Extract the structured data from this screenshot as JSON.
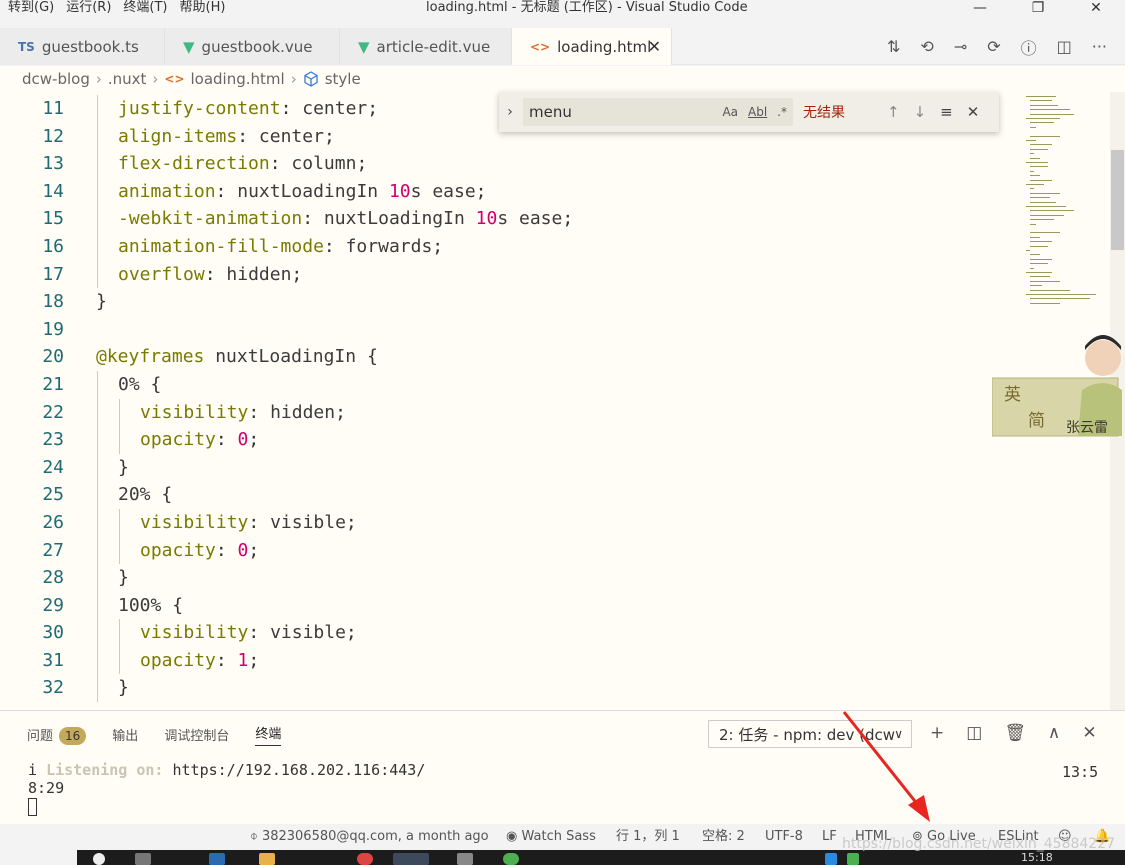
{
  "titlebar": {
    "menu": [
      "转到(G)",
      "运行(R)",
      "终端(T)",
      "帮助(H)"
    ],
    "title": "loading.html - 无标题 (工作区) - Visual Studio Code",
    "controls": [
      "—",
      "❐",
      "✕"
    ]
  },
  "tabs": [
    {
      "label": "guestbook.ts",
      "icon": "ts-icon",
      "icon_text": "TS"
    },
    {
      "label": "guestbook.vue",
      "icon": "vue-icon",
      "icon_text": "▼"
    },
    {
      "label": "article-edit.vue",
      "icon": "vue-icon",
      "icon_text": "▼"
    },
    {
      "label": "loading.html",
      "icon": "html-icon",
      "icon_text": "<>",
      "active": true,
      "close": "✕"
    }
  ],
  "tab_tools": [
    "⇅",
    "⟲",
    "⊸",
    "⟳",
    "ⓘ",
    "◫",
    "···"
  ],
  "breadcrumb": {
    "items": [
      "dcw-blog",
      ".nuxt",
      "loading.html",
      "style"
    ],
    "sep": "›"
  },
  "code": {
    "lines": [
      {
        "n": "11",
        "indent": 1,
        "parts": [
          [
            "prop",
            "justify-content"
          ],
          [
            "punc",
            ": "
          ],
          [
            "val",
            "center"
          ],
          [
            "punc",
            ";"
          ]
        ]
      },
      {
        "n": "12",
        "indent": 1,
        "parts": [
          [
            "prop",
            "align-items"
          ],
          [
            "punc",
            ": "
          ],
          [
            "val",
            "center"
          ],
          [
            "punc",
            ";"
          ]
        ]
      },
      {
        "n": "13",
        "indent": 1,
        "parts": [
          [
            "prop",
            "flex-direction"
          ],
          [
            "punc",
            ": "
          ],
          [
            "val",
            "column"
          ],
          [
            "punc",
            ";"
          ]
        ]
      },
      {
        "n": "14",
        "indent": 1,
        "parts": [
          [
            "prop",
            "animation"
          ],
          [
            "punc",
            ": "
          ],
          [
            "val",
            "nuxtLoadingIn "
          ],
          [
            "num",
            "10"
          ],
          [
            "unit",
            "s"
          ],
          [
            "val",
            " ease"
          ],
          [
            "punc",
            ";"
          ]
        ]
      },
      {
        "n": "15",
        "indent": 1,
        "parts": [
          [
            "prop",
            "-webkit-animation"
          ],
          [
            "punc",
            ": "
          ],
          [
            "val",
            "nuxtLoadingIn "
          ],
          [
            "num",
            "10"
          ],
          [
            "unit",
            "s"
          ],
          [
            "val",
            " ease"
          ],
          [
            "punc",
            ";"
          ]
        ]
      },
      {
        "n": "16",
        "indent": 1,
        "parts": [
          [
            "prop",
            "animation-fill-mode"
          ],
          [
            "punc",
            ": "
          ],
          [
            "val",
            "forwards"
          ],
          [
            "punc",
            ";"
          ]
        ]
      },
      {
        "n": "17",
        "indent": 1,
        "parts": [
          [
            "prop",
            "overflow"
          ],
          [
            "punc",
            ": "
          ],
          [
            "val",
            "hidden"
          ],
          [
            "punc",
            ";"
          ]
        ]
      },
      {
        "n": "18",
        "indent": 0,
        "parts": [
          [
            "punc",
            "}"
          ]
        ]
      },
      {
        "n": "19",
        "indent": 0,
        "parts": []
      },
      {
        "n": "20",
        "indent": 0,
        "parts": [
          [
            "at",
            "@keyframes"
          ],
          [
            "val",
            " nuxtLoadingIn "
          ],
          [
            "punc",
            "{"
          ]
        ]
      },
      {
        "n": "21",
        "indent": 1,
        "parts": [
          [
            "val",
            "0% "
          ],
          [
            "punc",
            "{"
          ]
        ]
      },
      {
        "n": "22",
        "indent": 2,
        "parts": [
          [
            "prop",
            "visibility"
          ],
          [
            "punc",
            ": "
          ],
          [
            "val",
            "hidden"
          ],
          [
            "punc",
            ";"
          ]
        ]
      },
      {
        "n": "23",
        "indent": 2,
        "parts": [
          [
            "prop",
            "opacity"
          ],
          [
            "punc",
            ": "
          ],
          [
            "num",
            "0"
          ],
          [
            "punc",
            ";"
          ]
        ]
      },
      {
        "n": "24",
        "indent": 1,
        "parts": [
          [
            "punc",
            "}"
          ]
        ]
      },
      {
        "n": "25",
        "indent": 1,
        "parts": [
          [
            "val",
            "20% "
          ],
          [
            "punc",
            "{"
          ]
        ]
      },
      {
        "n": "26",
        "indent": 2,
        "parts": [
          [
            "prop",
            "visibility"
          ],
          [
            "punc",
            ": "
          ],
          [
            "val",
            "visible"
          ],
          [
            "punc",
            ";"
          ]
        ]
      },
      {
        "n": "27",
        "indent": 2,
        "parts": [
          [
            "prop",
            "opacity"
          ],
          [
            "punc",
            ": "
          ],
          [
            "num",
            "0"
          ],
          [
            "punc",
            ";"
          ]
        ]
      },
      {
        "n": "28",
        "indent": 1,
        "parts": [
          [
            "punc",
            "}"
          ]
        ]
      },
      {
        "n": "29",
        "indent": 1,
        "parts": [
          [
            "val",
            "100% "
          ],
          [
            "punc",
            "{"
          ]
        ]
      },
      {
        "n": "30",
        "indent": 2,
        "parts": [
          [
            "prop",
            "visibility"
          ],
          [
            "punc",
            ": "
          ],
          [
            "val",
            "visible"
          ],
          [
            "punc",
            ";"
          ]
        ]
      },
      {
        "n": "31",
        "indent": 2,
        "parts": [
          [
            "prop",
            "opacity"
          ],
          [
            "punc",
            ": "
          ],
          [
            "num",
            "1"
          ],
          [
            "punc",
            ";"
          ]
        ]
      },
      {
        "n": "32",
        "indent": 1,
        "parts": [
          [
            "punc",
            "}"
          ]
        ]
      }
    ]
  },
  "find": {
    "value": "menu",
    "toggle": "›",
    "options": [
      "Aa",
      "Abl",
      ".*"
    ],
    "no_result": "无结果",
    "nav": [
      "↑",
      "↓",
      "≡",
      "✕"
    ]
  },
  "sticker": {
    "chars": [
      "英",
      "简"
    ],
    "signature": "张云雷"
  },
  "panel": {
    "tabs": [
      {
        "label": "问题",
        "badge": "16"
      },
      {
        "label": "输出"
      },
      {
        "label": "调试控制台"
      },
      {
        "label": "终端",
        "active": true
      }
    ],
    "terminal_select": "2: 任务 - npm: dev (dcw",
    "tools": [
      "+",
      "◫",
      "🗑",
      "∧",
      "✕"
    ],
    "terminal": {
      "prefix": "i ",
      "dim": "Listening on:",
      "url": " https://192.168.202.116:443/",
      "line2": "8:29",
      "time": "13:5"
    }
  },
  "statusbar": {
    "git": "382306580@qq.com, a month ago",
    "watch_sass": "Watch Sass",
    "position": "行 1，列 1",
    "spaces": "空格: 2",
    "encoding": "UTF-8",
    "eol": "LF",
    "language": "HTML",
    "go_live": "Go Live",
    "eslint": "ESLint",
    "watermark": "https://blog.csdn.net/weixin_45884227"
  },
  "taskbar": {
    "time": "15:18"
  },
  "colors": {
    "editor_bg": "#fffdf5",
    "property": "#7a7a00",
    "number": "#d0006f",
    "no_result": "#a1260d",
    "arrow": "#e8261f"
  }
}
